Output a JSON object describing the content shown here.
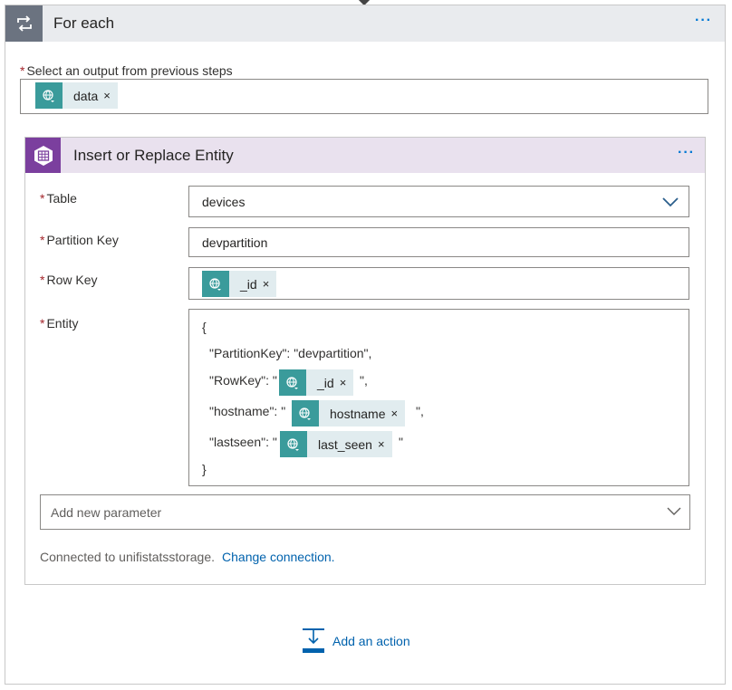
{
  "foreach": {
    "title": "For each",
    "menu_label": "···",
    "select_label": "Select an output from previous steps",
    "select_token": "data"
  },
  "action": {
    "title": "Insert or Replace Entity",
    "menu_label": "···",
    "table_label": "Table",
    "table_value": "devices",
    "partition_label": "Partition Key",
    "partition_value": "devpartition",
    "rowkey_label": "Row Key",
    "rowkey_token": "_id",
    "entity_label": "Entity",
    "entity": {
      "open": "{",
      "partition_line": "\"PartitionKey\": \"devpartition\",",
      "rowkey_prefix": "\"RowKey\": \"",
      "rowkey_token": "_id",
      "rowkey_suffix": "\",",
      "hostname_prefix": "\"hostname\": \"",
      "hostname_token": "hostname",
      "hostname_suffix": "\",",
      "lastseen_prefix": "\"lastseen\": \"",
      "lastseen_token": "last_seen",
      "lastseen_suffix": "\"",
      "close": "}"
    },
    "add_param_placeholder": "Add new parameter",
    "connection_text": "Connected to unifistatsstorage.",
    "change_connection": "Change connection."
  },
  "add_action_label": "Add an action",
  "required_mark": "*",
  "remove_mark": "×",
  "colors": {
    "accent": "#0078d4",
    "token_icon": "#3a9b9b",
    "token_bg": "#e1ecef",
    "foreach_header": "#e9ebee",
    "action_header": "#e9e1ee",
    "action_icon": "#7b3f9e"
  },
  "icons": {
    "foreach": "loop-icon",
    "token": "globe-icon",
    "action": "table-storage-icon",
    "add_action": "add-action-icon"
  }
}
